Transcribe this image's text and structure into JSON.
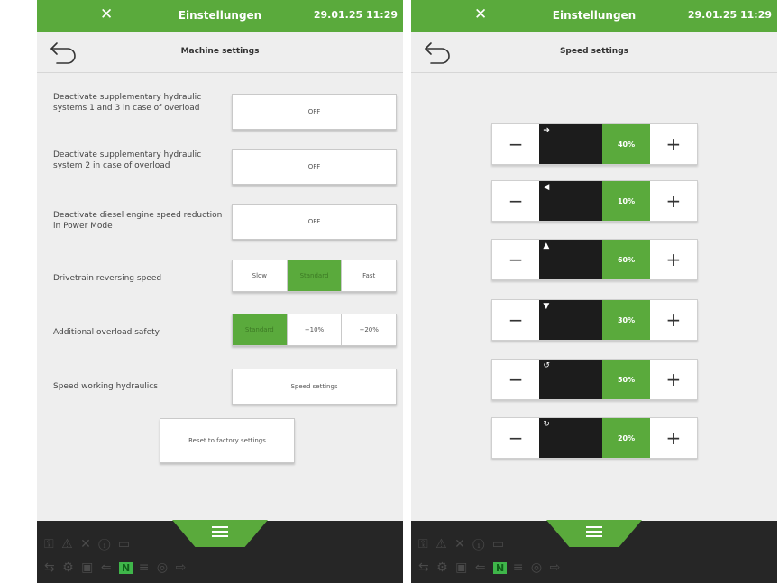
{
  "colors": {
    "accent": "#5aaa3c",
    "background": "#eeeeee",
    "bottombar": "#262626"
  },
  "left": {
    "header": {
      "tool_icon": "wrench-icon",
      "title": "Einstellungen",
      "datetime": "29.01.25 11:29"
    },
    "subtitle": "Machine settings",
    "settings": {
      "s1": {
        "label": "Deactivate supplementary hydraulic systems 1 and 3 in case of overload",
        "value": "OFF"
      },
      "s2": {
        "label": "Deactivate supplementary hydraulic system 2 in case of overload",
        "value": "OFF"
      },
      "s3": {
        "label": "Deactivate diesel engine speed reduction in Power Mode",
        "value": "OFF"
      },
      "reversing": {
        "label": "Drivetrain reversing speed",
        "options": [
          "Slow",
          "Standard",
          "Fast"
        ],
        "selected": "Standard"
      },
      "overload": {
        "label": "Additional overload safety",
        "options": [
          "Standard",
          "+10%",
          "+20%"
        ],
        "selected": "Standard"
      },
      "hydraulics": {
        "label": "Speed working hydraulics",
        "button": "Speed settings"
      }
    },
    "reset_label": "Reset to factory settings"
  },
  "right": {
    "header": {
      "tool_icon": "wrench-icon",
      "title": "Einstellungen",
      "datetime": "29.01.25 11:29"
    },
    "subtitle": "Speed settings",
    "rows": [
      {
        "icon": "telehandler-arrow-right-icon",
        "minus": "−",
        "value": "40%",
        "plus": "+"
      },
      {
        "icon": "telehandler-arrow-left-icon",
        "minus": "−",
        "value": "10%",
        "plus": "+"
      },
      {
        "icon": "telehandler-arrow-up-icon",
        "minus": "−",
        "value": "60%",
        "plus": "+"
      },
      {
        "icon": "telehandler-arrow-down-icon",
        "minus": "−",
        "value": "30%",
        "plus": "+"
      },
      {
        "icon": "telehandler-tilt-in-icon",
        "minus": "−",
        "value": "50%",
        "plus": "+"
      },
      {
        "icon": "telehandler-tilt-out-icon",
        "minus": "−",
        "value": "20%",
        "plus": "+"
      }
    ]
  },
  "bottom": {
    "menu_icon": "hamburger-menu-icon",
    "gear_indicator": "N"
  }
}
